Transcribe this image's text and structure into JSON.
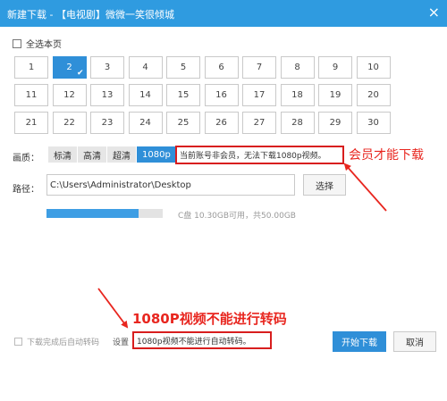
{
  "window": {
    "title": "新建下载 - 【电视剧】微微一笑很倾城",
    "close_glyph": "×"
  },
  "select_all": {
    "label": "全选本页"
  },
  "episodes": {
    "items": [
      "1",
      "2",
      "3",
      "4",
      "5",
      "6",
      "7",
      "8",
      "9",
      "10",
      "11",
      "12",
      "13",
      "14",
      "15",
      "16",
      "17",
      "18",
      "19",
      "20",
      "21",
      "22",
      "23",
      "24",
      "25",
      "26",
      "27",
      "28",
      "29",
      "30"
    ],
    "selected": "2"
  },
  "quality": {
    "label": "画质：",
    "options": [
      "标清",
      "高清",
      "超清",
      "1080p"
    ],
    "selected": "1080p"
  },
  "notice": "当前账号非会员，无法下载1080p视频。",
  "annotations": {
    "member_only": "会员才能下载",
    "no_transcode": "1080P视频不能进行转码",
    "color": "#e8261f"
  },
  "path": {
    "label": "路径：",
    "value": "C:\\Users\\Administrator\\Desktop",
    "browse_label": "选择"
  },
  "disk": {
    "used_fraction": 0.79,
    "text": "C盘 10.30GB可用，共50.00GB"
  },
  "footer": {
    "auto_transcode_label": "下载完成后自动转码",
    "settings_label": "设置",
    "transcode_notice": "1080p视频不能进行自动转码。",
    "start_label": "开始下载",
    "cancel_label": "取消"
  },
  "colors": {
    "accent": "#2f8fd8",
    "titlebar": "#2f9be0",
    "highlight_border": "#d81e1e"
  }
}
